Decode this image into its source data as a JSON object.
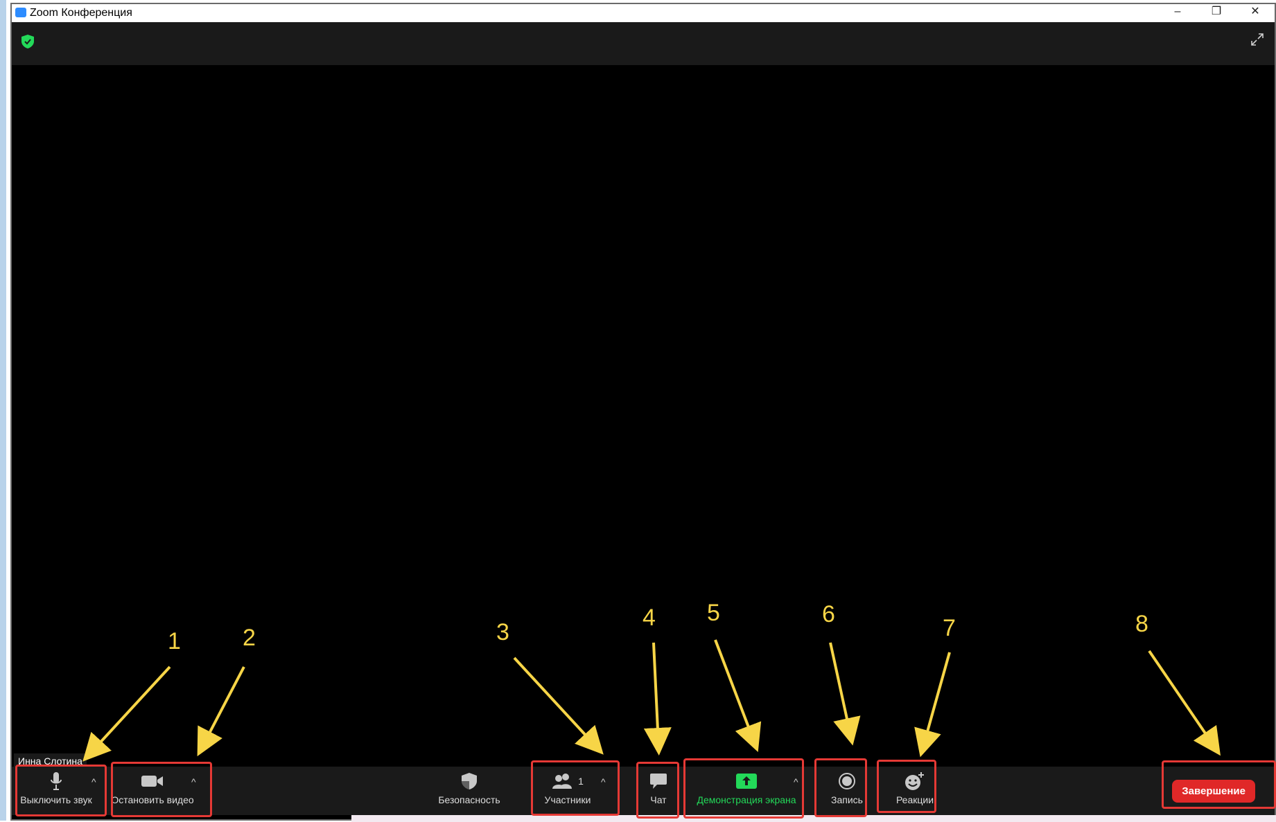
{
  "window": {
    "title": "Zoom Конференция",
    "minimize": "–",
    "restore": "❐",
    "close": "✕"
  },
  "participant_name": "Инна Слотина",
  "toolbar": {
    "mute_label": "Выключить звук",
    "video_label": "Остановить видео",
    "security_label": "Безопасность",
    "participants_label": "Участники",
    "participants_count": "1",
    "chat_label": "Чат",
    "share_label": "Демонстрация экрана",
    "record_label": "Запись",
    "reactions_label": "Реакции",
    "end_label": "Завершение",
    "caret": "^"
  },
  "annotations": [
    "1",
    "2",
    "3",
    "4",
    "5",
    "6",
    "7",
    "8"
  ],
  "colors": {
    "annotation": "#f7d547",
    "highlight_box": "#e53935",
    "share_green": "#23d959",
    "end_red": "#e02828",
    "shield_green": "#23d959"
  }
}
